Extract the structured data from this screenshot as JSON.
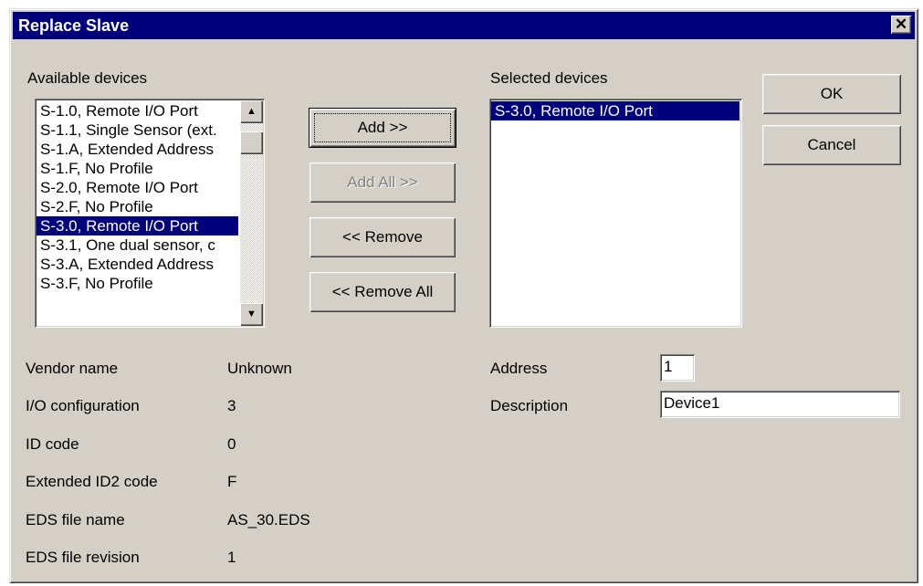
{
  "dialog": {
    "title": "Replace Slave",
    "close_glyph": "✕"
  },
  "available": {
    "label": "Available devices",
    "items": [
      {
        "label": "S-1.0, Remote I/O Port",
        "selected": false
      },
      {
        "label": "S-1.1, Single Sensor (ext.",
        "selected": false
      },
      {
        "label": "S-1.A, Extended Address",
        "selected": false
      },
      {
        "label": "S-1.F, No Profile",
        "selected": false
      },
      {
        "label": "S-2.0, Remote I/O Port",
        "selected": false
      },
      {
        "label": "S-2.F, No Profile",
        "selected": false
      },
      {
        "label": "S-3.0, Remote I/O Port",
        "selected": true
      },
      {
        "label": "S-3.1, One dual sensor, c",
        "selected": false
      },
      {
        "label": "S-3.A, Extended Address",
        "selected": false
      },
      {
        "label": "S-3.F, No Profile",
        "selected": false
      }
    ],
    "scroll_up_glyph": "▲",
    "scroll_down_glyph": "▼"
  },
  "buttons": {
    "add": "Add >>",
    "add_all": "Add All >>",
    "remove": "<< Remove",
    "remove_all": "<< Remove All",
    "ok": "OK",
    "cancel": "Cancel"
  },
  "selected": {
    "label": "Selected devices",
    "items": [
      {
        "label": "S-3.0, Remote I/O Port",
        "selected": true
      }
    ]
  },
  "info": {
    "vendor_name": {
      "label": "Vendor name",
      "value": "Unknown"
    },
    "io_configuration": {
      "label": "I/O configuration",
      "value": "3"
    },
    "id_code": {
      "label": "ID code",
      "value": "0"
    },
    "extended_id2_code": {
      "label": "Extended ID2 code",
      "value": "F"
    },
    "eds_file_name": {
      "label": "EDS file name",
      "value": "AS_30.EDS"
    },
    "eds_file_revision": {
      "label": "EDS file revision",
      "value": "1"
    }
  },
  "address": {
    "label": "Address",
    "value": "1"
  },
  "description": {
    "label": "Description",
    "value": "Device1"
  }
}
